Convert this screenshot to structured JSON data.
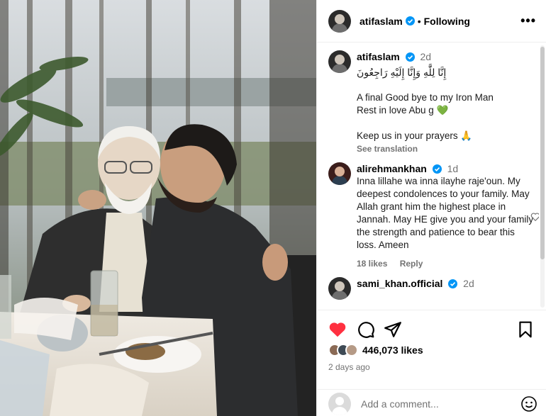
{
  "post": {
    "author": "atifaslam",
    "follow_status": "Following",
    "separator": "•",
    "more_label": "•••"
  },
  "caption": {
    "author": "atifaslam",
    "time": "2d",
    "arabic": "إِنَّا لِلَّٰهِ وَإِنَّا إِلَيْهِ رَاجِعُونَ",
    "line1": "A final Good bye to my Iron Man\nRest in love Abu g 💚",
    "line2": "Keep us in your prayers 🙏",
    "see_translation": "See translation"
  },
  "comments": [
    {
      "author": "alirehmankhan",
      "time": "1d",
      "text": "Inna lillahe wa inna ilayhe raje'oun. My deepest condolences to your family. May Allah grant him the highest place in Jannah. May HE give you and your family the strength and patience to bear this loss. Ameen",
      "likes": "18 likes",
      "reply": "Reply"
    },
    {
      "author": "sami_khan.official",
      "time": "2d"
    }
  ],
  "actions": {
    "likes_count": "446,073 likes",
    "posted_ago": "2 days ago",
    "comment_placeholder": "Add a comment..."
  },
  "icons": {
    "like": "heart-filled-icon",
    "comment": "comment-bubble-icon",
    "share": "paper-plane-icon",
    "save": "bookmark-icon",
    "emoji": "smiley-icon",
    "verified": "verified-badge-icon"
  },
  "colors": {
    "like_red": "#ff3040",
    "verified_blue": "#0095f6",
    "muted_text": "#737373"
  }
}
